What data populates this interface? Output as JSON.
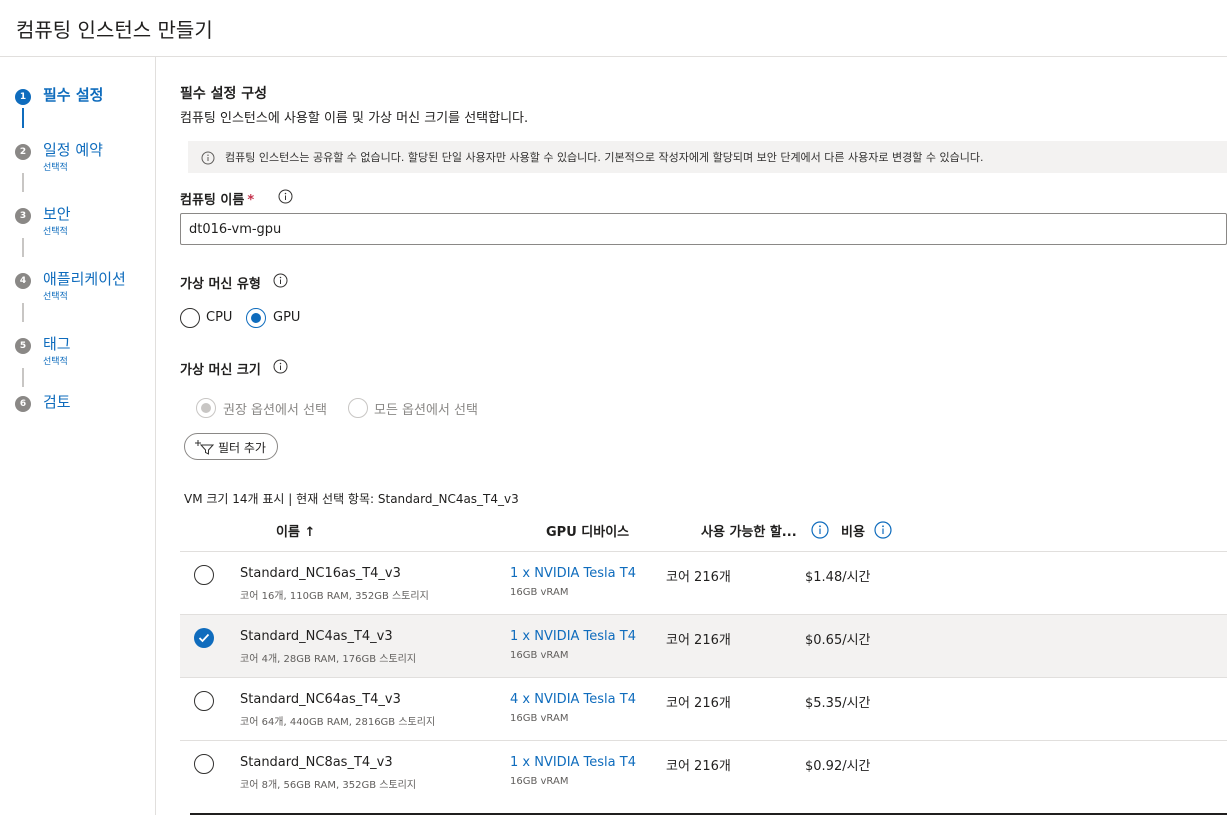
{
  "header": {
    "title": "컴퓨팅 인스턴스 만들기"
  },
  "sidebar": {
    "steps": [
      {
        "number": "1",
        "label": "필수 설정",
        "sub": ""
      },
      {
        "number": "2",
        "label": "일정 예약",
        "sub": "선택적"
      },
      {
        "number": "3",
        "label": "보안",
        "sub": "선택적"
      },
      {
        "number": "4",
        "label": "애플리케이션",
        "sub": "선택적"
      },
      {
        "number": "5",
        "label": "태그",
        "sub": "선택적"
      },
      {
        "number": "6",
        "label": "검토",
        "sub": ""
      }
    ]
  },
  "main": {
    "section_title": "필수 설정 구성",
    "section_desc": "컴퓨팅 인스턴스에 사용할 이름 및 가상 머신 크기를 선택합니다.",
    "info_text": "컴퓨팅 인스턴스는 공유할 수 없습니다. 할당된 단일 사용자만 사용할 수 있습니다. 기본적으로 작성자에게 할당되며 보안 단계에서 다른 사용자로 변경할 수 있습니다.",
    "name_label": "컴퓨팅 이름",
    "name_required": "*",
    "name_value": "dt016-vm-gpu",
    "vm_type_label": "가상 머신 유형",
    "vm_type_options": [
      "CPU",
      "GPU"
    ],
    "vm_type_selected": "GPU",
    "vm_size_label": "가상 머신 크기",
    "vm_size_options": [
      "권장 옵션에서 선택",
      "모든 옵션에서 선택"
    ],
    "filter_label": "필터 추가",
    "summary": "VM 크기 14개 표시 | 현재 선택 항목: Standard_NC4as_T4_v3",
    "columns": {
      "name": "이름 ↑",
      "gpu": "GPU 디바이스",
      "available": "사용 가능한 할...",
      "cost": "비용"
    },
    "rows": [
      {
        "name": "Standard_NC16as_T4_v3",
        "spec": "코어 16개, 110GB RAM, 352GB 스토리지",
        "gpu": "1 x NVIDIA Tesla T4",
        "vram": "16GB vRAM",
        "cores": "코어 216개",
        "cost": "$1.48/시간",
        "selected": false
      },
      {
        "name": "Standard_NC4as_T4_v3",
        "spec": "코어 4개, 28GB RAM, 176GB 스토리지",
        "gpu": "1 x NVIDIA Tesla T4",
        "vram": "16GB vRAM",
        "cores": "코어 216개",
        "cost": "$0.65/시간",
        "selected": true
      },
      {
        "name": "Standard_NC64as_T4_v3",
        "spec": "코어 64개, 440GB RAM, 2816GB 스토리지",
        "gpu": "4 x NVIDIA Tesla T4",
        "vram": "16GB vRAM",
        "cores": "코어 216개",
        "cost": "$5.35/시간",
        "selected": false
      },
      {
        "name": "Standard_NC8as_T4_v3",
        "spec": "코어 8개, 56GB RAM, 352GB 스토리지",
        "gpu": "1 x NVIDIA Tesla T4",
        "vram": "16GB vRAM",
        "cores": "코어 216개",
        "cost": "$0.92/시간",
        "selected": false
      }
    ]
  },
  "colors": {
    "accent": "#0f6cbd",
    "required": "#c4314b",
    "selected_row": "#f3f2f1"
  },
  "icons": {
    "info": "info-circle-icon",
    "filter": "filter-add-icon",
    "check": "checkmark-icon"
  }
}
